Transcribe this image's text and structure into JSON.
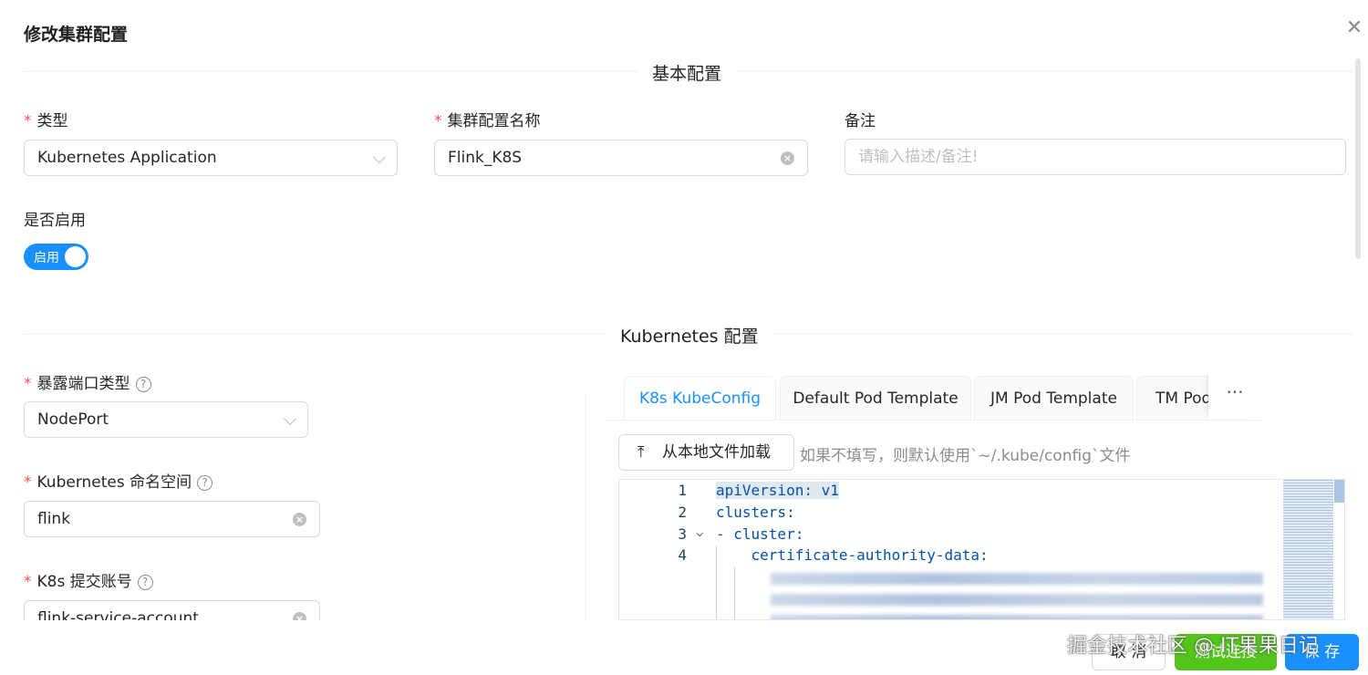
{
  "dialog": {
    "title": "修改集群配置",
    "close_glyph": "✕"
  },
  "basic": {
    "section_label": "基本配置",
    "type": {
      "label": "类型",
      "value": "Kubernetes Application"
    },
    "name": {
      "label": "集群配置名称",
      "value": "Flink_K8S"
    },
    "note": {
      "label": "备注",
      "placeholder": "请输入描述/备注!"
    },
    "enabled": {
      "label": "是否启用",
      "switch_text": "启用",
      "on": true
    }
  },
  "k8s": {
    "section_label": "Kubernetes 配置",
    "expose_type": {
      "label": "暴露端口类型",
      "value": "NodePort"
    },
    "namespace": {
      "label": "Kubernetes 命名空间",
      "value": "flink"
    },
    "account": {
      "label": "K8s 提交账号",
      "value": "flink-service-account"
    },
    "help_glyph": "?"
  },
  "tabs": [
    {
      "label": "K8s KubeConfig",
      "active": true
    },
    {
      "label": "Default Pod Template",
      "active": false
    },
    {
      "label": "JM Pod Template",
      "active": false
    },
    {
      "label": "TM Pod Template",
      "active": false
    }
  ],
  "tabs_more": "···",
  "upload": {
    "icon": "upload-icon",
    "label": "从本地文件加载",
    "hint": "如果不填写，则默认使用`~/.kube/config`文件"
  },
  "editor": {
    "lines": [
      {
        "n": "1",
        "text": "apiVersion: v1"
      },
      {
        "n": "2",
        "text": "clusters:"
      },
      {
        "n": "3",
        "text": "- cluster:"
      },
      {
        "n": "4",
        "text": "    certificate-authority-data:"
      }
    ]
  },
  "footer": {
    "cancel": "取 消",
    "test": "测试连接",
    "save": "保 存"
  },
  "watermark": "掘金技术社区 @ IT果果日记",
  "colors": {
    "primary": "#1890ff",
    "success": "#52c41a",
    "required": "#ff4d4f"
  }
}
